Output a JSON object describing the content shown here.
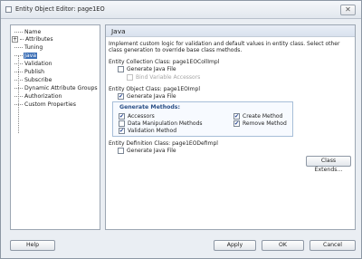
{
  "window": {
    "title": "Entity Object Editor: page1EO",
    "close": "✕"
  },
  "nav": {
    "items": [
      {
        "label": "Name"
      },
      {
        "label": "Attributes",
        "expander": "+"
      },
      {
        "label": "Tuning"
      },
      {
        "label": "Java"
      },
      {
        "label": "Validation"
      },
      {
        "label": "Publish"
      },
      {
        "label": "Subscribe"
      },
      {
        "label": "Dynamic Attribute Groups"
      },
      {
        "label": "Authorization"
      },
      {
        "label": "Custom Properties"
      }
    ]
  },
  "panel": {
    "title": "Java",
    "description": "Implement custom logic for validation and default values in entity class. Select other class generation to override base class methods.",
    "collection_class": {
      "label": "Entity Collection Class: page1EOCollImpl",
      "generate": {
        "label": "Generate Java File",
        "checked": false
      },
      "bind": {
        "label": "Bind Variable Accessors",
        "checked": false
      }
    },
    "object_class": {
      "label": "Entity Object Class: page1EOImpl",
      "generate": {
        "label": "Generate Java File",
        "checked": true
      },
      "methods": {
        "title": "Generate Methods:",
        "accessors": {
          "label": "Accessors",
          "checked": true
        },
        "dml": {
          "label": "Data Manipulation Methods",
          "checked": false
        },
        "validation": {
          "label": "Validation Method",
          "checked": true
        },
        "create": {
          "label": "Create Method",
          "checked": true
        },
        "remove": {
          "label": "Remove Method",
          "checked": true
        }
      }
    },
    "definition_class": {
      "label": "Entity Definition Class: page1EODefImpl",
      "generate": {
        "label": "Generate Java File",
        "checked": false
      }
    },
    "class_extends_button": "Class Extends..."
  },
  "footer": {
    "help": "Help",
    "apply": "Apply",
    "ok": "OK",
    "cancel": "Cancel"
  },
  "check_glyph": "✔"
}
